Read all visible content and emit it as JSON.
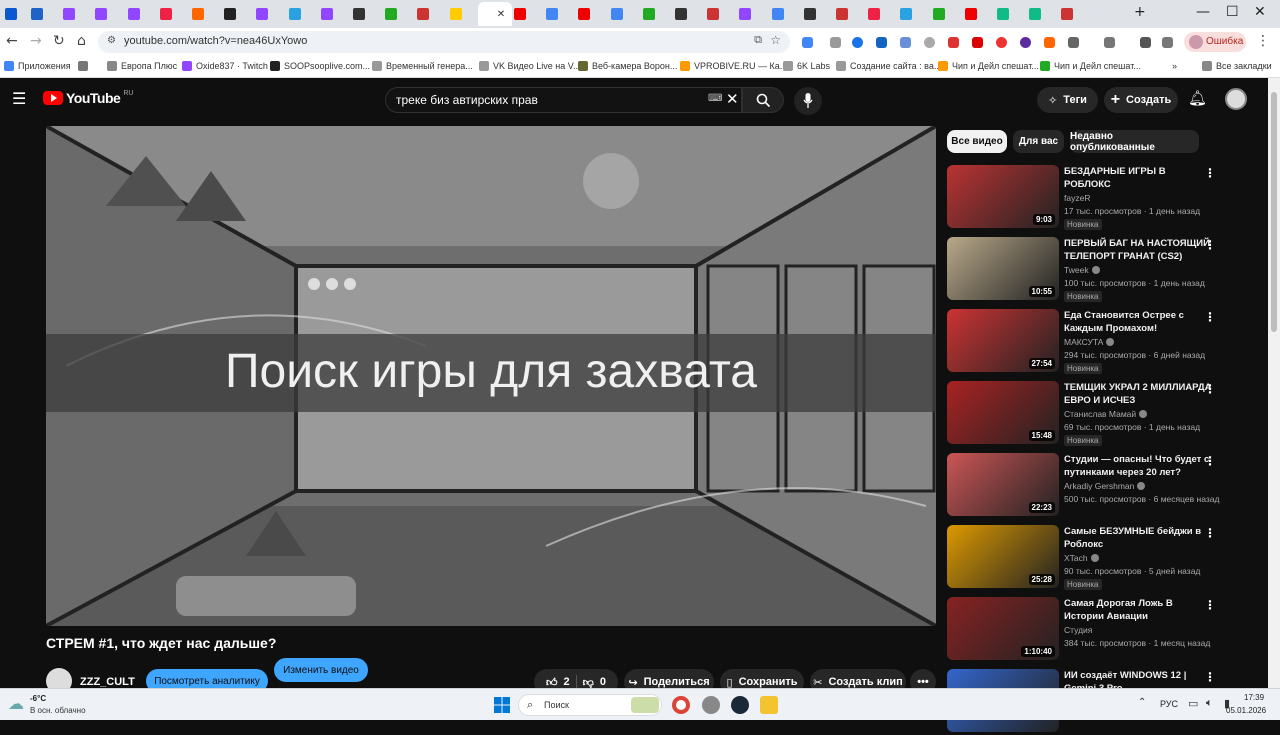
{
  "browser": {
    "url": "youtube.com/watch?v=nea46UxYowo",
    "error_label": "Ошибка",
    "tabs": [
      {
        "color": "#1e63c5"
      },
      {
        "color": "#9146ff"
      },
      {
        "color": "#9146ff"
      },
      {
        "color": "#9146ff"
      },
      {
        "color": "#e24"
      },
      {
        "color": "#f60"
      },
      {
        "color": "#222"
      },
      {
        "color": "#9146ff"
      },
      {
        "color": "#2aa1e0"
      },
      {
        "color": "#9146ff"
      },
      {
        "color": "#333"
      },
      {
        "color": "#2a2"
      },
      {
        "color": "#c33"
      },
      {
        "color": "#fc0"
      },
      {
        "color": "#fff",
        "active": true
      },
      {
        "color": "#e00"
      },
      {
        "color": "#4285f4"
      },
      {
        "color": "#e00"
      },
      {
        "color": "#4285f4"
      },
      {
        "color": "#2a2"
      },
      {
        "color": "#333"
      },
      {
        "color": "#c33"
      },
      {
        "color": "#9146ff"
      },
      {
        "color": "#4285f4"
      },
      {
        "color": "#333"
      },
      {
        "color": "#c33"
      },
      {
        "color": "#e24"
      },
      {
        "color": "#2aa1e0"
      },
      {
        "color": "#2a2"
      },
      {
        "color": "#e00"
      },
      {
        "color": "#1b8"
      },
      {
        "color": "#1b8"
      },
      {
        "color": "#c33"
      }
    ],
    "bookmarks": [
      {
        "label": "Приложения",
        "color": "#4285f4"
      },
      {
        "label": "",
        "color": "#777"
      },
      {
        "label": "Европа Плюс",
        "color": "#888"
      },
      {
        "label": "Oxide837 · Twitch",
        "color": "#9146ff"
      },
      {
        "label": "SOOPsooplive.com...",
        "color": "#222"
      },
      {
        "label": "Временный генера...",
        "color": "#999"
      },
      {
        "label": "VK Видео Live на V...",
        "color": "#999"
      },
      {
        "label": "Веб-камера Ворон...",
        "color": "#663"
      },
      {
        "label": "VPROBIVE.RU — Ка...",
        "color": "#f90"
      },
      {
        "label": "6K Labs",
        "color": "#999"
      },
      {
        "label": "Создание сайта : ва...",
        "color": "#999"
      },
      {
        "label": "Чип и Дейл спешат...",
        "color": "#f90"
      },
      {
        "label": "Чип и Дейл спешат...",
        "color": "#2a2"
      },
      {
        "label": "Все закладки",
        "color": "#888"
      }
    ]
  },
  "youtube": {
    "logo_text": "YouTube",
    "region": "RU",
    "search_query": "треке биз автирских прав",
    "tags_label": "Теги",
    "create_label": "Создать",
    "video": {
      "frame_caption": "Поиск игры для захвата",
      "title": "СТРЕМ #1, что ждет нас дальше?",
      "channel": "ZZZ_CULT",
      "analytics_label": "Посмотреть аналитику",
      "edit_label": "Изменить видео",
      "likes": "2",
      "dislikes": "0",
      "share_label": "Поделиться",
      "save_label": "Сохранить",
      "clip_label": "Создать клип"
    },
    "chips": [
      "Все видео",
      "Для вас",
      "Недавно опубликованные"
    ],
    "recommendations": [
      {
        "title": "БЕЗДАРНЫЕ ИГРЫ В РОБЛОКС",
        "channel": "fayzeR",
        "verified": false,
        "meta": "17 тыс. просмотров · 1 день назад",
        "badge": "Новинка",
        "duration": "9:03",
        "thumb": "#b33"
      },
      {
        "title": "ПЕРВЫЙ БАГ НА НАСТОЯЩИЙ ТЕЛЕПОРТ ГРАНАТ (CS2)",
        "channel": "Tweek",
        "verified": true,
        "meta": "100 тыс. просмотров · 1 день назад",
        "badge": "Новинка",
        "duration": "10:55",
        "thumb": "#b9a98a"
      },
      {
        "title": "Еда Становится Острее с Каждым Промахом!",
        "channel": "МАКСУТА",
        "verified": true,
        "meta": "294 тыс. просмотров · 6 дней назад",
        "badge": "Новинка",
        "duration": "27:54",
        "thumb": "#c33"
      },
      {
        "title": "ТЕМЩИК УКРАЛ 2 МИЛЛИАРДА ЕВРО И ИСЧЕЗ",
        "channel": "Станислав Мамай",
        "verified": true,
        "meta": "69 тыс. просмотров · 1 день назад",
        "badge": "Новинка",
        "duration": "15:48",
        "thumb": "#a22"
      },
      {
        "title": "Студии — опасны! Что будет с путинками через 20 лет?",
        "channel": "Arkadiy Gershman",
        "verified": true,
        "meta": "500 тыс. просмотров · 6 месяцев назад",
        "badge": "",
        "duration": "22:23",
        "thumb": "#c55"
      },
      {
        "title": "Самые БЕЗУМНЫЕ бейджи в Роблокс",
        "channel": "XTach",
        "verified": true,
        "meta": "90 тыс. просмотров · 5 дней назад",
        "badge": "Новинка",
        "duration": "25:28",
        "thumb": "#d90"
      },
      {
        "title": "Самая Дорогая Ложь В Истории Авиации",
        "channel": "Студия",
        "verified": false,
        "meta": "384 тыс. просмотров · 1 месяц назад",
        "badge": "",
        "duration": "1:10:40",
        "thumb": "#822"
      },
      {
        "title": "ИИ создаёт WINDOWS 12 | Gemini 3 Pro",
        "channel": "",
        "verified": false,
        "meta": "",
        "badge": "",
        "duration": "",
        "thumb": "#36c"
      }
    ]
  },
  "taskbar": {
    "weather_temp": "-6°C",
    "weather_desc": "В осн. облачно",
    "search_label": "Поиск",
    "lang": "РУС",
    "time": "17:39",
    "date": "05.01.2026"
  }
}
